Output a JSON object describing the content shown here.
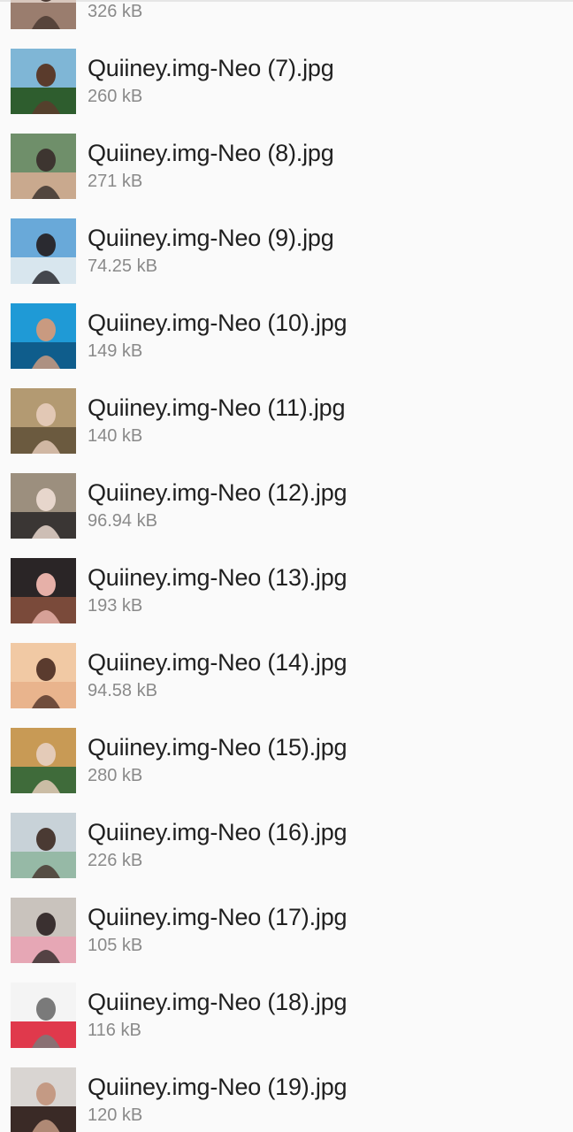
{
  "files": [
    {
      "name": "",
      "size": "326 kB",
      "thumb": [
        "#d8c7bd",
        "#9a7d6e",
        "#4b3a33"
      ]
    },
    {
      "name": "Quiiney.img-Neo (7).jpg",
      "size": "260 kB",
      "thumb": [
        "#7fb6d6",
        "#2e5d2e",
        "#5a3b2c"
      ]
    },
    {
      "name": "Quiiney.img-Neo (8).jpg",
      "size": "271 kB",
      "thumb": [
        "#6f8f6a",
        "#c9a98e",
        "#3d3530"
      ]
    },
    {
      "name": "Quiiney.img-Neo (9).jpg",
      "size": "74.25 kB",
      "thumb": [
        "#69a9d9",
        "#d8e6ee",
        "#2a2a30"
      ]
    },
    {
      "name": "Quiiney.img-Neo (10).jpg",
      "size": "149 kB",
      "thumb": [
        "#1f9ad6",
        "#0f5d8c",
        "#c99a80"
      ]
    },
    {
      "name": "Quiiney.img-Neo (11).jpg",
      "size": "140 kB",
      "thumb": [
        "#b39a72",
        "#6b5a3f",
        "#e2c8b5"
      ]
    },
    {
      "name": "Quiiney.img-Neo (12).jpg",
      "size": "96.94 kB",
      "thumb": [
        "#9c8f7e",
        "#3a3634",
        "#e7d6cc"
      ]
    },
    {
      "name": "Quiiney.img-Neo (13).jpg",
      "size": "193 kB",
      "thumb": [
        "#2a2526",
        "#7a4a3a",
        "#e6b0a8"
      ]
    },
    {
      "name": "Quiiney.img-Neo (14).jpg",
      "size": "94.58 kB",
      "thumb": [
        "#f1c9a4",
        "#e9b48d",
        "#5a3b2e"
      ]
    },
    {
      "name": "Quiiney.img-Neo (15).jpg",
      "size": "280 kB",
      "thumb": [
        "#c89a55",
        "#3f6b3a",
        "#e4cbb8"
      ]
    },
    {
      "name": "Quiiney.img-Neo (16).jpg",
      "size": "226 kB",
      "thumb": [
        "#c8d2d8",
        "#96b9a6",
        "#4a3a33"
      ]
    },
    {
      "name": "Quiiney.img-Neo (17).jpg",
      "size": "105 kB",
      "thumb": [
        "#c9c3bd",
        "#e6a7b5",
        "#3a3030"
      ]
    },
    {
      "name": "Quiiney.img-Neo (18).jpg",
      "size": "116 kB",
      "thumb": [
        "#f4f4f4",
        "#e0394c",
        "#7a7a7a"
      ]
    },
    {
      "name": "Quiiney.img-Neo (19).jpg",
      "size": "120 kB",
      "thumb": [
        "#d9d5d2",
        "#3a2a26",
        "#c49a84"
      ]
    }
  ],
  "thumb_icon": "photo-thumbnail-icon"
}
